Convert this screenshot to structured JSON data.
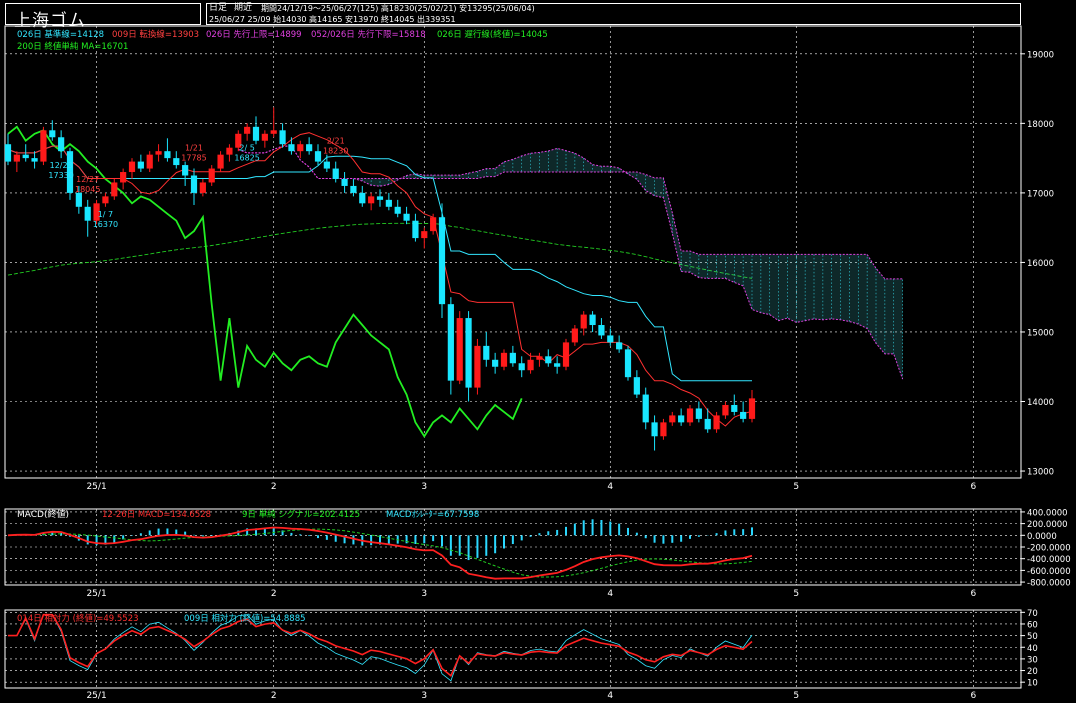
{
  "header": {
    "title": "上海ゴム",
    "period_type": "日足",
    "period_mode": "期近",
    "line1": "期間24/12/19〜25/06/27(125) 高18230(25/02/21) 安13295(25/06/04)",
    "line2": "25/06/27 25/09 始14030 高14165 安13970 終14045 出339351"
  },
  "legend_main": {
    "kijun": "026日 基準線=14128",
    "tenkan": "009日 転換線=13903",
    "senkou_a": "026日 先行上限=14899",
    "senkou_b": "052/026日 先行下限=15818",
    "chikou": "026日 遅行線(終値)=14045",
    "ma200": "200日 終値単純 MA=16701"
  },
  "legend_macd": {
    "title": "MACD(終値)",
    "macd": "12-26日 MACD=134.6528",
    "signal": "9日 単純 シグナル=202.4125",
    "osc": "MACDｵｼﾚｰﾀｰ=67.7598"
  },
  "legend_rsi": {
    "rsi14": "014日 相対力 (終値)=49.5523",
    "rsi9": "009日 相対力 (終値)=54.8885"
  },
  "colors": {
    "up": "#ff1a1a",
    "down": "#19e6ff",
    "kijun": "#32e6ff",
    "tenkan": "#ff3030",
    "cloud": "#e040e0",
    "chikou": "#22ee22",
    "ma": "#22cc22",
    "grid": "#ffffff"
  },
  "chart_data": [
    {
      "type": "candlestick",
      "title": "上海ゴム",
      "x_tick_labels": [
        "25/1",
        "2",
        "3",
        "4",
        "5",
        "6"
      ],
      "y_ticks": [
        13000,
        14000,
        15000,
        16000,
        17000,
        18000,
        19000
      ],
      "ylim": [
        12900,
        19400
      ],
      "annotations": [
        {
          "date_index": 6,
          "lines": [
            "12/23",
            "17330"
          ]
        },
        {
          "date_index": 9,
          "lines": [
            "12/27",
            "18045"
          ]
        },
        {
          "date_index": 11,
          "lines": [
            "1/ 7",
            "16370"
          ]
        },
        {
          "date_index": 21,
          "lines": [
            "1/21",
            "17785"
          ]
        },
        {
          "date_index": 27,
          "lines": [
            "2/ 5",
            "16825"
          ]
        },
        {
          "date_index": 37,
          "lines": [
            "2/21",
            "18230"
          ]
        }
      ],
      "candles_ohlc": [
        [
          17700,
          17850,
          17400,
          17450
        ],
        [
          17450,
          17600,
          17300,
          17550
        ],
        [
          17550,
          17700,
          17450,
          17500
        ],
        [
          17500,
          17600,
          17350,
          17450
        ],
        [
          17450,
          17950,
          17400,
          17900
        ],
        [
          17900,
          18045,
          17750,
          17800
        ],
        [
          17800,
          17900,
          17500,
          17600
        ],
        [
          17600,
          17650,
          16900,
          17000
        ],
        [
          17000,
          17100,
          16700,
          16800
        ],
        [
          16800,
          16900,
          16370,
          16600
        ],
        [
          16600,
          16900,
          16550,
          16850
        ],
        [
          16850,
          17000,
          16800,
          16950
        ],
        [
          16950,
          17200,
          16900,
          17150
        ],
        [
          17150,
          17350,
          17050,
          17300
        ],
        [
          17300,
          17500,
          17200,
          17450
        ],
        [
          17450,
          17550,
          17300,
          17350
        ],
        [
          17350,
          17600,
          17300,
          17550
        ],
        [
          17550,
          17700,
          17450,
          17600
        ],
        [
          17600,
          17785,
          17450,
          17500
        ],
        [
          17500,
          17600,
          17350,
          17400
        ],
        [
          17400,
          17450,
          17100,
          17250
        ],
        [
          17250,
          17350,
          16825,
          17000
        ],
        [
          17000,
          17200,
          16950,
          17150
        ],
        [
          17150,
          17400,
          17100,
          17350
        ],
        [
          17350,
          17600,
          17300,
          17550
        ],
        [
          17550,
          17700,
          17450,
          17650
        ],
        [
          17650,
          17900,
          17600,
          17850
        ],
        [
          17850,
          18000,
          17750,
          17950
        ],
        [
          17950,
          18100,
          17700,
          17750
        ],
        [
          17750,
          17900,
          17650,
          17850
        ],
        [
          17850,
          18230,
          17800,
          17900
        ],
        [
          17900,
          18000,
          17650,
          17700
        ],
        [
          17700,
          17800,
          17550,
          17600
        ],
        [
          17600,
          17750,
          17500,
          17700
        ],
        [
          17700,
          17800,
          17550,
          17600
        ],
        [
          17600,
          17700,
          17400,
          17450
        ],
        [
          17450,
          17550,
          17300,
          17350
        ],
        [
          17350,
          17450,
          17150,
          17200
        ],
        [
          17200,
          17300,
          17000,
          17100
        ],
        [
          17100,
          17200,
          16950,
          17000
        ],
        [
          17000,
          17100,
          16800,
          16850
        ],
        [
          16850,
          17000,
          16750,
          16950
        ],
        [
          16950,
          17050,
          16800,
          16900
        ],
        [
          16900,
          17000,
          16750,
          16800
        ],
        [
          16800,
          16900,
          16650,
          16700
        ],
        [
          16700,
          16800,
          16550,
          16600
        ],
        [
          16600,
          16700,
          16300,
          16350
        ],
        [
          16350,
          16500,
          16200,
          16450
        ],
        [
          16450,
          16700,
          16400,
          16650
        ],
        [
          16650,
          16850,
          15200,
          15400
        ],
        [
          15400,
          15500,
          14100,
          14300
        ],
        [
          14300,
          15300,
          14250,
          15200
        ],
        [
          15200,
          15300,
          14000,
          14200
        ],
        [
          14200,
          14900,
          14100,
          14800
        ],
        [
          14800,
          15000,
          14500,
          14600
        ],
        [
          14600,
          14700,
          14400,
          14500
        ],
        [
          14500,
          14750,
          14450,
          14700
        ],
        [
          14700,
          14800,
          14500,
          14550
        ],
        [
          14550,
          14650,
          14350,
          14450
        ],
        [
          14450,
          14700,
          14400,
          14600
        ],
        [
          14600,
          14700,
          14500,
          14650
        ],
        [
          14650,
          14750,
          14500,
          14550
        ],
        [
          14550,
          14650,
          14400,
          14500
        ],
        [
          14500,
          14900,
          14450,
          14850
        ],
        [
          14850,
          15100,
          14800,
          15050
        ],
        [
          15050,
          15300,
          14950,
          15250
        ],
        [
          15250,
          15300,
          15000,
          15100
        ],
        [
          15100,
          15200,
          14900,
          14950
        ],
        [
          14950,
          15050,
          14800,
          14850
        ],
        [
          14850,
          14950,
          14700,
          14750
        ],
        [
          14750,
          14800,
          14300,
          14350
        ],
        [
          14350,
          14450,
          14050,
          14100
        ],
        [
          14100,
          14200,
          13600,
          13700
        ],
        [
          13700,
          13800,
          13295,
          13500
        ],
        [
          13500,
          13750,
          13450,
          13700
        ],
        [
          13700,
          13850,
          13650,
          13800
        ],
        [
          13800,
          13900,
          13650,
          13700
        ],
        [
          13700,
          13950,
          13650,
          13900
        ],
        [
          13900,
          14000,
          13700,
          13750
        ],
        [
          13750,
          13900,
          13550,
          13600
        ],
        [
          13600,
          13850,
          13550,
          13800
        ],
        [
          13800,
          14000,
          13750,
          13950
        ],
        [
          13950,
          14100,
          13800,
          13850
        ],
        [
          13850,
          14000,
          13700,
          13750
        ],
        [
          13750,
          14165,
          13700,
          14045
        ]
      ]
    },
    {
      "type": "macd",
      "y_ticks": [
        400,
        200,
        0,
        -200,
        -400,
        -600,
        -800
      ],
      "y_tick_labels": [
        "400.0000",
        "200.0000",
        "0.0000",
        "-200.0000",
        "-400.0000",
        "-600.0000",
        "-800.0000"
      ],
      "ylim": [
        -850,
        450
      ],
      "macd_final": 134.6528,
      "signal_final": 202.4125,
      "oscillator_final": 67.7598
    },
    {
      "type": "rsi",
      "y_ticks": [
        10,
        20,
        30,
        40,
        50,
        60,
        70
      ],
      "ylim": [
        5,
        72
      ],
      "rsi14_final": 49.5523,
      "rsi9_final": 54.8885
    }
  ]
}
